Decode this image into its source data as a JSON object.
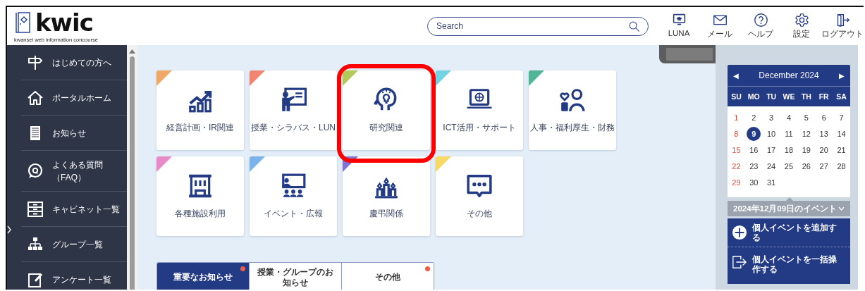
{
  "header": {
    "logo": {
      "wordmark": "kwic",
      "tagline": "kwansei web information concourse"
    },
    "search": {
      "placeholder": "Search"
    },
    "nav": [
      {
        "label": "LUNA"
      },
      {
        "label": "メール"
      },
      {
        "label": "ヘルプ"
      },
      {
        "label": "設定"
      },
      {
        "label": "ログアウト"
      }
    ]
  },
  "sidebar": {
    "items": [
      {
        "label": "はじめての方へ"
      },
      {
        "label": "ポータルホーム"
      },
      {
        "label": "お知らせ"
      },
      {
        "label": "よくある質問（FAQ）"
      },
      {
        "label": "キャビネット一覧"
      },
      {
        "label": "グループ一覧"
      },
      {
        "label": "アンケート一覧"
      }
    ]
  },
  "tiles": [
    {
      "label": "経営計画・IR関連",
      "color": "#f0a868",
      "highlighted": false
    },
    {
      "label": "授業・シラバス・LUN",
      "color": "#f28472",
      "highlighted": false
    },
    {
      "label": "研究関連",
      "color": "#b4c85c",
      "highlighted": true
    },
    {
      "label": "ICT活用・サポート",
      "color": "#74d2e2",
      "highlighted": false
    },
    {
      "label": "人事・福利厚生・財務",
      "color": "#52b496",
      "highlighted": false
    },
    {
      "label": "各種施設利用",
      "color": "#e88ac8",
      "highlighted": false
    },
    {
      "label": "イベント・広報",
      "color": "#7ab2ea",
      "highlighted": false
    },
    {
      "label": "慶弔関係",
      "color": "#8272d2",
      "highlighted": false
    },
    {
      "label": "その他",
      "color": "#f8d864",
      "highlighted": false
    }
  ],
  "notice_tabs": [
    {
      "label": "重要なお知らせ",
      "selected": true,
      "unread": true
    },
    {
      "label": "授業・グループのお知らせ",
      "selected": false,
      "unread": false
    },
    {
      "label": "その他",
      "selected": false,
      "unread": true
    }
  ],
  "calendar": {
    "prev": "◀",
    "month": "December 2024",
    "next": "▶",
    "weekdays": [
      "SU",
      "MO",
      "TU",
      "WE",
      "TH",
      "FR",
      "SA"
    ],
    "days": [
      {
        "label": "1",
        "kind": "sunday",
        "selected": false
      },
      {
        "label": "2",
        "kind": "weekday",
        "selected": false
      },
      {
        "label": "3",
        "kind": "weekday",
        "selected": false
      },
      {
        "label": "4",
        "kind": "weekday",
        "selected": false
      },
      {
        "label": "5",
        "kind": "weekday",
        "selected": false
      },
      {
        "label": "6",
        "kind": "weekday",
        "selected": false
      },
      {
        "label": "7",
        "kind": "weekday",
        "selected": false
      },
      {
        "label": "8",
        "kind": "sunday",
        "selected": false
      },
      {
        "label": "9",
        "kind": "weekday",
        "selected": true
      },
      {
        "label": "10",
        "kind": "weekday",
        "selected": false
      },
      {
        "label": "11",
        "kind": "weekday",
        "selected": false
      },
      {
        "label": "12",
        "kind": "weekday",
        "selected": false
      },
      {
        "label": "13",
        "kind": "weekday",
        "selected": false
      },
      {
        "label": "14",
        "kind": "weekday",
        "selected": false
      },
      {
        "label": "15",
        "kind": "sunday",
        "selected": false
      },
      {
        "label": "16",
        "kind": "weekday",
        "selected": false
      },
      {
        "label": "17",
        "kind": "weekday",
        "selected": false
      },
      {
        "label": "18",
        "kind": "weekday",
        "selected": false
      },
      {
        "label": "19",
        "kind": "weekday",
        "selected": false
      },
      {
        "label": "20",
        "kind": "weekday",
        "selected": false
      },
      {
        "label": "21",
        "kind": "weekday",
        "selected": false
      },
      {
        "label": "22",
        "kind": "sunday",
        "selected": false
      },
      {
        "label": "23",
        "kind": "weekday",
        "selected": false
      },
      {
        "label": "24",
        "kind": "weekday",
        "selected": false
      },
      {
        "label": "25",
        "kind": "weekday",
        "selected": false
      },
      {
        "label": "26",
        "kind": "weekday",
        "selected": false
      },
      {
        "label": "27",
        "kind": "weekday",
        "selected": false
      },
      {
        "label": "28",
        "kind": "weekday",
        "selected": false
      },
      {
        "label": "29",
        "kind": "sunday",
        "selected": false
      },
      {
        "label": "30",
        "kind": "weekday",
        "selected": false
      },
      {
        "label": "31",
        "kind": "weekday",
        "selected": false
      }
    ],
    "events_label": "2024年12月09日のイベント",
    "actions": [
      {
        "label": "個人イベントを追加する"
      },
      {
        "label": "個人イベントを一括操作する"
      }
    ]
  }
}
